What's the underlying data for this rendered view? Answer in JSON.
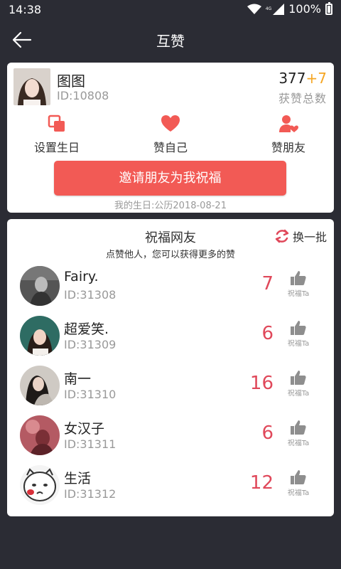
{
  "status": {
    "time": "14:38",
    "network": "4G",
    "battery": "100%"
  },
  "appbar": {
    "title": "互赞"
  },
  "profile": {
    "name": "图图",
    "id": "ID:10808",
    "likes": "377",
    "likes_plus": "+7",
    "likes_label": "获赞总数"
  },
  "actions": [
    {
      "label": "设置生日",
      "icon": "calendar-icon"
    },
    {
      "label": "赞自己",
      "icon": "heart-icon"
    },
    {
      "label": "赞朋友",
      "icon": "user-heart-icon"
    }
  ],
  "invite_button": "邀请朋友为我祝福",
  "birthday_text": "我的生日:公历2018-08-21",
  "friends_section": {
    "title": "祝福网友",
    "subtitle": "点赞他人，您可以获得更多的赞",
    "refresh_label": "换一批",
    "like_label": "祝福Ta",
    "rows": [
      {
        "name": "Fairy.",
        "id": "ID:31308",
        "count": "7"
      },
      {
        "name": "超爱笑.",
        "id": "ID:31309",
        "count": "6"
      },
      {
        "name": "南一",
        "id": "ID:31310",
        "count": "16"
      },
      {
        "name": "女汉子",
        "id": "ID:31311",
        "count": "6"
      },
      {
        "name": "生活",
        "id": "ID:31312",
        "count": "12"
      }
    ]
  },
  "colors": {
    "accent": "#f25a55",
    "count": "#e0485a",
    "plus": "#f5a623",
    "background": "#2b2c34"
  }
}
